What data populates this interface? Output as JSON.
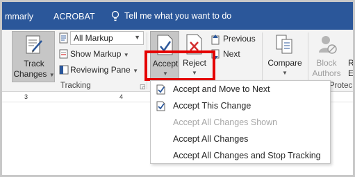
{
  "tabs": {
    "summary": "mmarly",
    "acrobat": "ACROBAT",
    "tell_me": "Tell me what you want to do"
  },
  "ribbon": {
    "track_changes": {
      "line1": "Track",
      "line2": "Changes"
    },
    "all_markup": "All Markup",
    "show_markup": "Show Markup",
    "reviewing_pane": "Reviewing Pane",
    "tracking_group": "Tracking",
    "accept": "Accept",
    "reject": "Reject",
    "previous": "Previous",
    "next": "Next",
    "compare": "Compare",
    "block_authors": {
      "line1": "Block",
      "line2": "Authors"
    },
    "restrict_partial": {
      "line1": "R",
      "line2": "E"
    },
    "protect_partial": "Protec"
  },
  "ruler": {
    "marks": [
      "3",
      "4"
    ]
  },
  "accept_menu": {
    "items": [
      {
        "label": "Accept and Move to Next",
        "enabled": true,
        "icon": "accept-move-icon"
      },
      {
        "label": "Accept This Change",
        "enabled": true,
        "icon": "accept-change-icon"
      },
      {
        "label": "Accept All Changes Shown",
        "enabled": false,
        "icon": ""
      },
      {
        "label": "Accept All Changes",
        "enabled": true,
        "icon": ""
      },
      {
        "label": "Accept All Changes and Stop Tracking",
        "enabled": true,
        "icon": ""
      }
    ]
  },
  "colors": {
    "title_bar": "#2b579a",
    "ribbon_bg": "#f3f3f3",
    "selected_button": "#c6c6c6",
    "highlight_box": "#e50000",
    "disabled_text": "#a6a6a6"
  }
}
